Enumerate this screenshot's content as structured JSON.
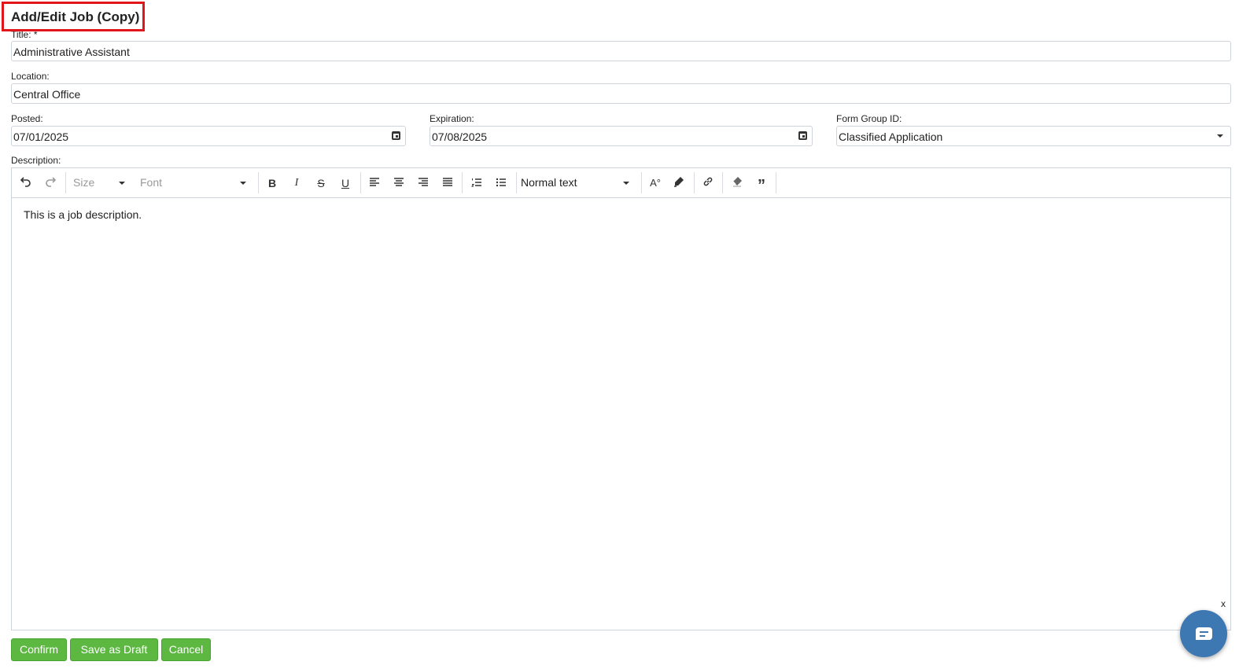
{
  "page_title": "Add/Edit Job (Copy)",
  "form": {
    "title": {
      "label": "Title: *",
      "value": "Administrative Assistant"
    },
    "location": {
      "label": "Location:",
      "value": "Central Office"
    },
    "posted": {
      "label": "Posted:",
      "value": "07/01/2025"
    },
    "expiration": {
      "label": "Expiration:",
      "value": "07/08/2025"
    },
    "form_group": {
      "label": "Form Group ID:",
      "value": "Classified Application"
    },
    "description": {
      "label": "Description:",
      "value": "This is a job description."
    }
  },
  "toolbar": {
    "size_placeholder": "Size",
    "font_placeholder": "Font",
    "block_format": "Normal text",
    "bold": "B",
    "italic": "I",
    "strike": "S",
    "underline": "U",
    "font_color": "A°",
    "quote": "”"
  },
  "buttons": {
    "confirm": "Confirm",
    "save_draft": "Save as Draft",
    "cancel": "Cancel"
  },
  "chat": {
    "close": "x"
  },
  "colors": {
    "accent_green": "#5cb841",
    "title_border": "#e0161b",
    "chat_blue": "#3e78b3"
  }
}
